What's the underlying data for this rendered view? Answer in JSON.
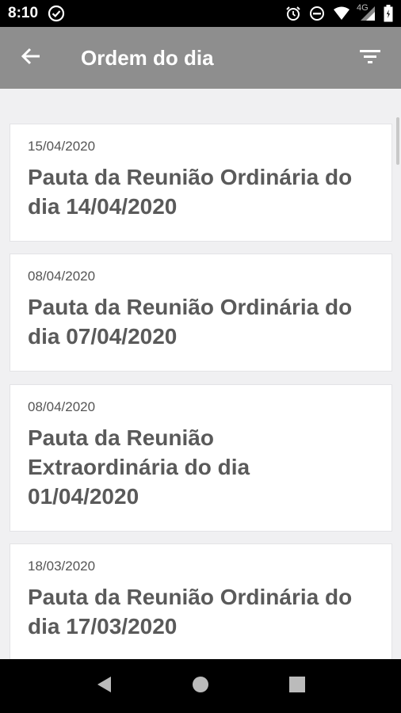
{
  "status_bar": {
    "time": "8:10",
    "network": "4G",
    "icons": [
      "check-circle-icon",
      "alarm-icon",
      "do-not-disturb-icon",
      "wifi-icon",
      "cell-signal-icon",
      "battery-icon"
    ]
  },
  "app_bar": {
    "title": "Ordem do dia",
    "back_icon": "arrow-back-icon",
    "filter_icon": "filter-icon",
    "color": "#8e8e8e"
  },
  "items": [
    {
      "date": "15/04/2020",
      "title": "Pauta da Reunião Ordinária do dia 14/04/2020"
    },
    {
      "date": "08/04/2020",
      "title": "Pauta da Reunião Ordinária do dia 07/04/2020"
    },
    {
      "date": "08/04/2020",
      "title": "Pauta da Reunião Extraordinária do dia 01/04/2020"
    },
    {
      "date": "18/03/2020",
      "title": "Pauta da Reunião Ordinária do dia 17/03/2020"
    }
  ],
  "nav_bar": {
    "icons": [
      "back-triangle-icon",
      "home-circle-icon",
      "recents-square-icon"
    ]
  }
}
